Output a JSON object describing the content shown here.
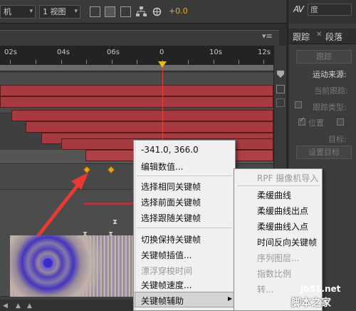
{
  "toolbar": {
    "camera_dropdown": "机",
    "view_dropdown": "1 视图",
    "exposure_value": "+0.0"
  },
  "right_panel": {
    "character_field": "度",
    "tabs": [
      "跟踪",
      "段落"
    ],
    "track_button": "跟踪",
    "motion_source_label": "运动来源:",
    "current_track_label": "当前跟踪:",
    "track_type_label": "跟踪类型:",
    "position_label": "位置",
    "target_label": "目标:",
    "set_target_button": "设置目标"
  },
  "timeline": {
    "ruler_ticks": [
      "02s",
      "04s",
      "06s",
      "0",
      "10s",
      "12s"
    ]
  },
  "context_menu": {
    "coords": "-341.0, 366.0",
    "items": [
      "编辑数值...",
      "选择相同关键帧",
      "选择前面关键帧",
      "选择跟随关键帧",
      "切换保持关键帧",
      "关键帧插值...",
      "漂浮穿梭时间",
      "关键帧速度...",
      "关键帧辅助"
    ],
    "submenu_arrow": "▶"
  },
  "submenu": {
    "items": [
      "RPF 摄像机导入",
      "柔缓曲线",
      "柔缓曲线出点",
      "柔缓曲线入点",
      "时间反向关键帧",
      "序列图层...",
      "指数比例",
      "转..."
    ]
  },
  "watermark": {
    "url": "jb51.net",
    "name": "脚本之家"
  },
  "colors": {
    "layer_bar": "#a63a40",
    "playhead": "#e8402f",
    "keyframe": "#e8a020",
    "menu_bg": "#f0f0f0"
  }
}
